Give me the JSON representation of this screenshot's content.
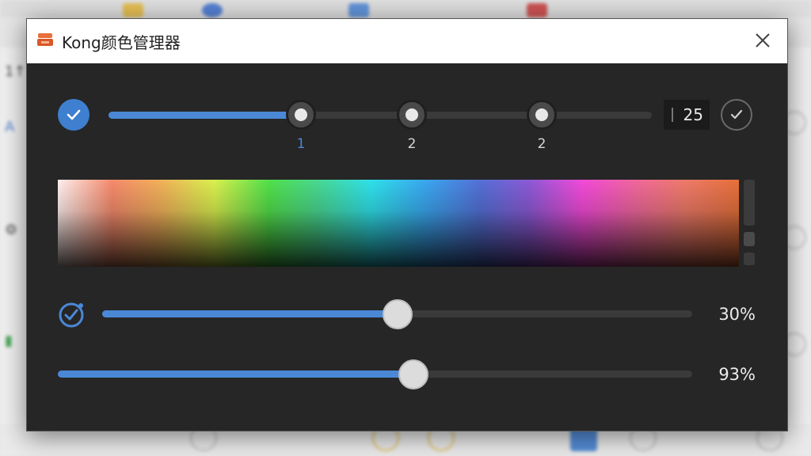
{
  "window": {
    "title": "Kong颜色管理器",
    "logo_icon": "stacked-boxes-icon"
  },
  "background": {
    "left_glyphs": [
      "1↑",
      "A",
      "⚙",
      "▮"
    ]
  },
  "stop_slider": {
    "stops": [
      "1",
      "2",
      "2"
    ],
    "active_stop": 0,
    "value_text": "25",
    "accent": "#4a88d6"
  },
  "spectrum": {
    "colors": [
      "#fff0ee",
      "#f58a6c",
      "#f2b05a",
      "#d9f04e",
      "#52e04a",
      "#49d890",
      "#2fe0ea",
      "#3aa6ef",
      "#5470d6",
      "#8a5ad6",
      "#f24ad8",
      "#f0689a",
      "#ee7a6a",
      "#e6703a"
    ]
  },
  "sliders": [
    {
      "value_text": "30%",
      "fill_fraction": 0.5,
      "icon": "check-badge-icon"
    },
    {
      "value_text": "93%",
      "fill_fraction": 0.56
    }
  ]
}
